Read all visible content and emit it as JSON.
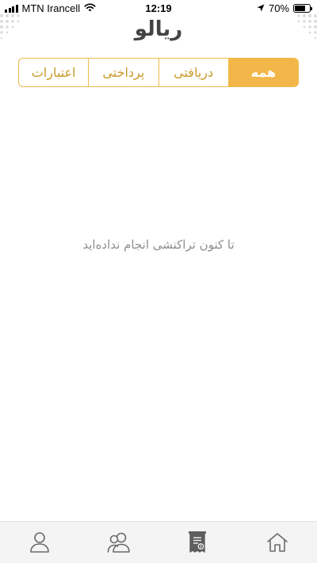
{
  "status_bar": {
    "carrier": "MTN Irancell",
    "time": "12:19",
    "battery": "70%",
    "battery_level": 0.7,
    "icons": [
      "signal-icon",
      "wifi-icon",
      "location-arrow-icon",
      "battery-icon"
    ]
  },
  "app": {
    "logo_text": "ریالو"
  },
  "tabs": [
    {
      "label": "اعتبارات",
      "active": false
    },
    {
      "label": "پرداختی",
      "active": false
    },
    {
      "label": "دریافتی",
      "active": false
    },
    {
      "label": "همه",
      "active": true
    }
  ],
  "empty_state": {
    "message": "تا کنون تراکنشی انجام نداده‌اید"
  },
  "bottom_nav": {
    "items": [
      "profile-icon",
      "contacts-icon",
      "transactions-icon",
      "home-icon"
    ],
    "active": "transactions-icon"
  },
  "colors": {
    "accent": "#f2b748",
    "accent_border": "#f0b94a",
    "tab_text": "#c99a2b",
    "nav_icon": "#6a6a6a",
    "nav_bg": "#f4f4f4",
    "empty_text": "#8e8e8e"
  }
}
